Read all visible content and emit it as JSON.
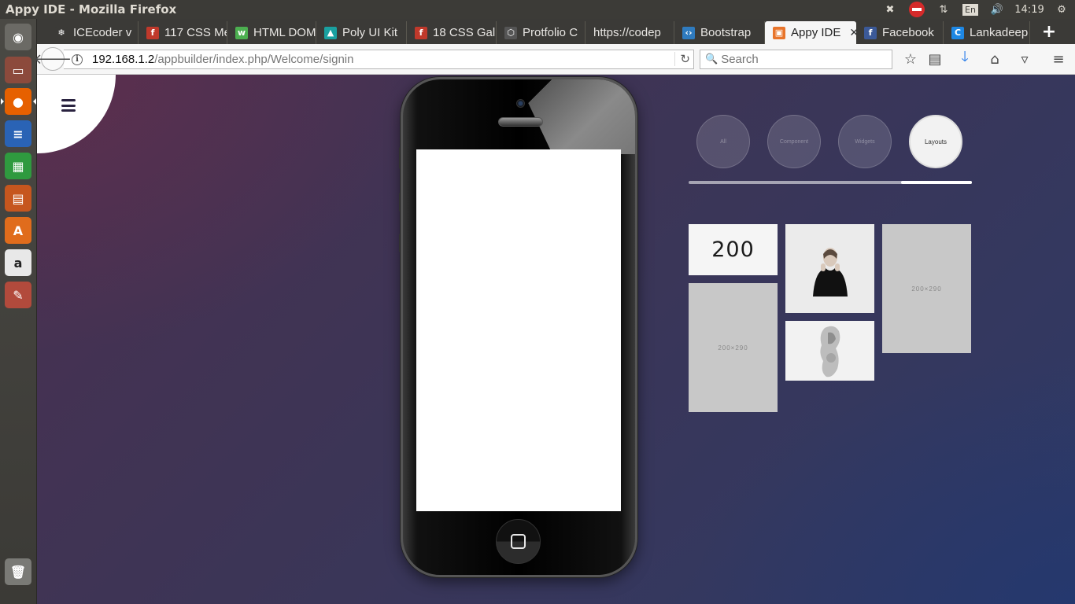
{
  "window": {
    "title": "Appy IDE - Mozilla Firefox"
  },
  "system_tray": {
    "keyboard_layout": "En",
    "clock": "14:19"
  },
  "launcher": {
    "items": [
      {
        "name": "dash",
        "glyph": "◉",
        "color": "#6b6a65"
      },
      {
        "name": "files",
        "glyph": "▭",
        "color": "#8c4a3c"
      },
      {
        "name": "firefox",
        "glyph": "●",
        "color": "#e66000"
      },
      {
        "name": "writer",
        "glyph": "≡",
        "color": "#2a63b5"
      },
      {
        "name": "calc",
        "glyph": "▦",
        "color": "#2f9a3f"
      },
      {
        "name": "impress",
        "glyph": "▤",
        "color": "#c6561e"
      },
      {
        "name": "software-center",
        "glyph": "A",
        "color": "#e06c1c"
      },
      {
        "name": "amazon",
        "glyph": "a",
        "color": "#e8e8e8"
      },
      {
        "name": "system-settings",
        "glyph": "✎",
        "color": "#b24a3c"
      },
      {
        "name": "trash",
        "glyph": "🗑",
        "color": "#7a7a76"
      }
    ]
  },
  "tabs": [
    {
      "label": "ICEcoder v",
      "favicon": "❄",
      "fav_color": "#3b3a37"
    },
    {
      "label": "117 CSS Me",
      "favicon": "f",
      "fav_color": "#c0392b"
    },
    {
      "label": "HTML DOM",
      "favicon": "w",
      "fav_color": "#4caf50"
    },
    {
      "label": "Poly UI Kit",
      "favicon": "▲",
      "fav_color": "#1aa0a0"
    },
    {
      "label": "18 CSS Gall",
      "favicon": "f",
      "fav_color": "#c0392b"
    },
    {
      "label": "Protfolio C",
      "favicon": "⬡",
      "fav_color": "#555"
    },
    {
      "label": "https://codep",
      "favicon": "",
      "fav_color": "#3b3a37"
    },
    {
      "label": "Bootstrap",
      "favicon": "‹›",
      "fav_color": "#2f7bbf"
    },
    {
      "label": "Appy IDE",
      "favicon": "▣",
      "fav_color": "#e8742a"
    },
    {
      "label": "Facebook",
      "favicon": "f",
      "fav_color": "#3b5998"
    },
    {
      "label": "Lankadeep",
      "favicon": "C",
      "fav_color": "#1e88e5"
    }
  ],
  "navbar": {
    "url_host": "192.168.1.2",
    "url_path": "/appbuilder/index.php/Welcome/signin",
    "search_placeholder": "Search"
  },
  "categories": [
    {
      "label": "All",
      "active": false
    },
    {
      "label": "Component",
      "active": false
    },
    {
      "label": "Widgets",
      "active": false
    },
    {
      "label": "Layouts",
      "active": true
    }
  ],
  "category_progress": {
    "start": 0.75,
    "end": 1.0
  },
  "tiles": {
    "number_tile": "200",
    "placeholder_right": "200×290",
    "placeholder_left": "200×290"
  }
}
